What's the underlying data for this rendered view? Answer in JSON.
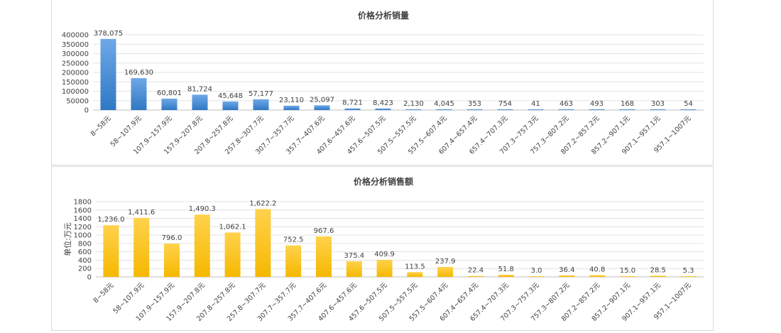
{
  "chart_data": [
    {
      "type": "bar",
      "title": "价格分析销量",
      "xlabel": "",
      "ylabel": "",
      "ylim": [
        0,
        400000
      ],
      "yticks": [
        "400000",
        "350000",
        "300000",
        "250000",
        "200000",
        "150000",
        "100000",
        "50000",
        "0"
      ],
      "categories": [
        "8~58元",
        "58~107.9元",
        "107.9~157.9元",
        "157.9~207.8元",
        "207.8~257.8元",
        "257.8~307.7元",
        "307.7~357.7元",
        "357.7~407.6元",
        "407.6~457.6元",
        "457.6~507.5元",
        "507.5~557.5元",
        "557.5~607.4元",
        "607.4~657.4元",
        "657.4~707.3元",
        "707.3~757.3元",
        "757.3~807.2元",
        "807.2~857.2元",
        "857.2~907.1元",
        "907.1~957.1元",
        "957.1~1007元"
      ],
      "values": [
        378075,
        169630,
        60801,
        81724,
        45648,
        57177,
        23110,
        25097,
        8721,
        8423,
        2130,
        4045,
        353,
        754,
        41,
        463,
        493,
        168,
        303,
        54
      ],
      "labels": [
        "378,075",
        "169,630",
        "60,801",
        "81,724",
        "45,648",
        "57,177",
        "23,110",
        "25,097",
        "8,721",
        "8,423",
        "2,130",
        "4,045",
        "353",
        "754",
        "41",
        "463",
        "493",
        "168",
        "303",
        "54"
      ],
      "colors": {
        "bar_top": "#6fa8e8",
        "bar_bottom": "#2f78c4"
      },
      "grid": true,
      "legend": "none"
    },
    {
      "type": "bar",
      "title": "价格分析销售额",
      "xlabel": "",
      "ylabel": "单位:万元",
      "ylim": [
        0,
        1800
      ],
      "yticks": [
        "1800",
        "1600",
        "1400",
        "1200",
        "1000",
        "800",
        "600",
        "400",
        "200",
        "0"
      ],
      "categories": [
        "8~58元",
        "58~107.9元",
        "107.9~157.9元",
        "157.9~207.8元",
        "207.8~257.8元",
        "257.8~307.7元",
        "307.7~357.7元",
        "357.7~407.6元",
        "407.6~457.6元",
        "457.6~507.5元",
        "507.5~557.5元",
        "557.5~607.4元",
        "607.4~657.4元",
        "657.4~707.3元",
        "707.3~757.3元",
        "757.3~807.2元",
        "807.2~857.2元",
        "857.2~907.1元",
        "907.1~957.1元",
        "957.1~1007元"
      ],
      "values": [
        1236.0,
        1411.6,
        796.0,
        1490.3,
        1062.1,
        1622.2,
        752.5,
        967.6,
        375.4,
        409.9,
        113.5,
        237.9,
        22.4,
        51.8,
        3.0,
        36.4,
        40.8,
        15.0,
        28.5,
        5.3
      ],
      "labels": [
        "1,236.0",
        "1,411.6",
        "796.0",
        "1,490.3",
        "1,062.1",
        "1,622.2",
        "752.5",
        "967.6",
        "375.4",
        "409.9",
        "113.5",
        "237.9",
        "22.4",
        "51.8",
        "3.0",
        "36.4",
        "40.8",
        "15.0",
        "28.5",
        "5.3"
      ],
      "colors": {
        "bar_top": "#ffd24d",
        "bar_bottom": "#f5b800"
      },
      "grid": true,
      "legend": "none"
    }
  ]
}
